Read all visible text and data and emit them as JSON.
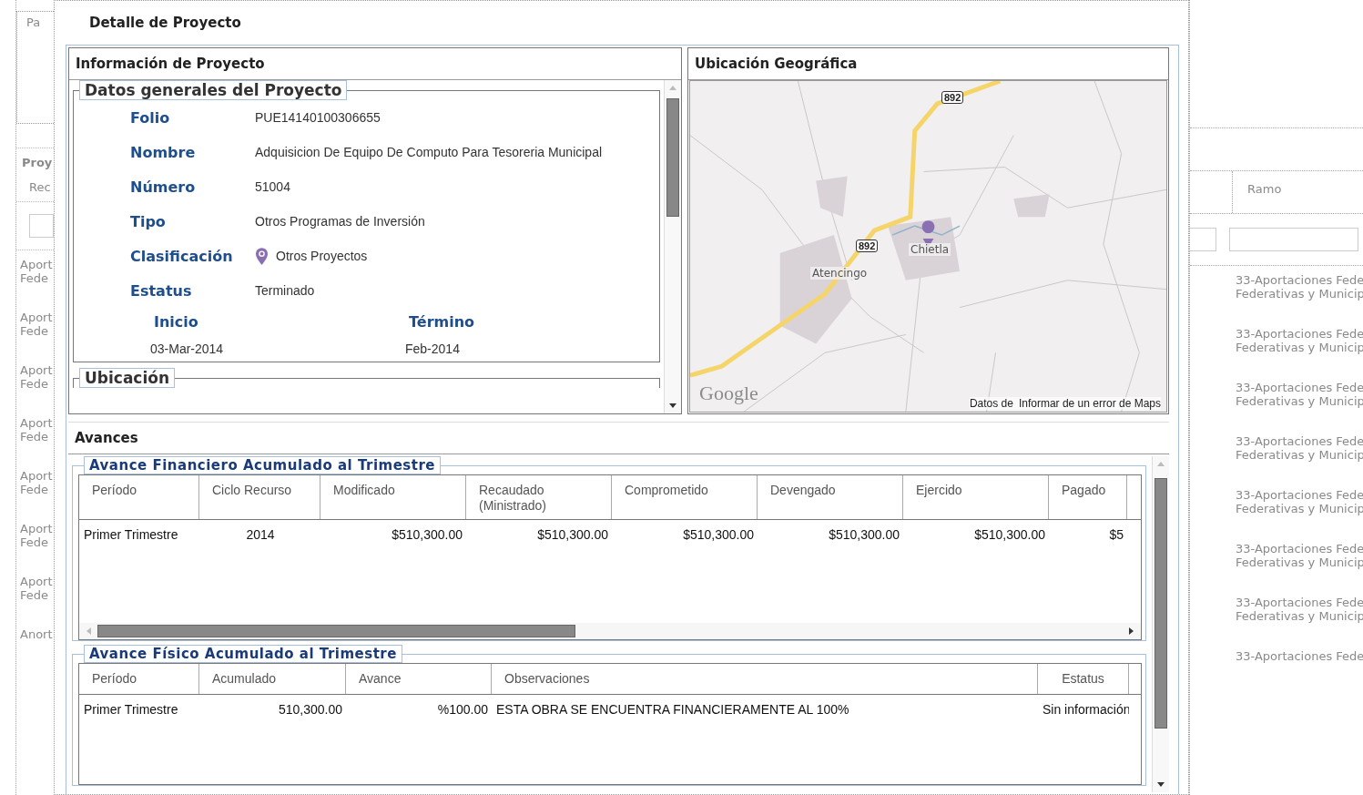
{
  "background_left": {
    "legend": "Pa",
    "panel_title": "Proy",
    "column_header": "Rec",
    "rows": [
      {
        "line_1": "Aport",
        "line_2": "Fede"
      },
      {
        "line_1": "Aport",
        "line_2": "Fede"
      },
      {
        "line_1": "Aport",
        "line_2": "Fede"
      },
      {
        "line_1": "Aport",
        "line_2": "Fede"
      },
      {
        "line_1": "Aport",
        "line_2": "Fede"
      },
      {
        "line_1": "Aport",
        "line_2": "Fede"
      },
      {
        "line_1": "Aport",
        "line_2": "Fede"
      },
      {
        "line_1": "Anort"
      }
    ]
  },
  "background_right": {
    "column_header": "Ramo",
    "rows": [
      {
        "line_1": "33-Aportaciones Fede",
        "line_2": "Federativas y Municip"
      },
      {
        "line_1": "33-Aportaciones Fede",
        "line_2": "Federativas y Municip"
      },
      {
        "line_1": "33-Aportaciones Fede",
        "line_2": "Federativas y Municip"
      },
      {
        "line_1": "33-Aportaciones Fede",
        "line_2": "Federativas y Municip"
      },
      {
        "line_1": "33-Aportaciones Fede",
        "line_2": "Federativas y Municip"
      },
      {
        "line_1": "33-Aportaciones Fede",
        "line_2": "Federativas y Municip"
      },
      {
        "line_1": "33-Aportaciones Fede",
        "line_2": "Federativas y Municip"
      },
      {
        "line_1": "33-Aportaciones Fede"
      }
    ]
  },
  "dialog": {
    "title": "Detalle de Proyecto",
    "info_panel": {
      "title": "Información de Proyecto",
      "section_title": "Datos generales del Proyecto",
      "fields": [
        {
          "label": "Folio",
          "value": "PUE14140100306655",
          "kind": "text"
        },
        {
          "label": "Nombre",
          "value": "Adquisicion De Equipo De Computo Para Tesoreria Municipal",
          "kind": "text"
        },
        {
          "label": "Número",
          "value": "51004",
          "kind": "text"
        },
        {
          "label": "Tipo",
          "value": "Otros Programas de Inversión",
          "kind": "text"
        },
        {
          "label": "Clasificación",
          "value": "Otros Proyectos",
          "kind": "pin"
        },
        {
          "label": "Estatus",
          "value": "Terminado",
          "kind": "text"
        }
      ],
      "dates": [
        {
          "label": "Inicio",
          "value": "03-Mar-2014"
        },
        {
          "label": "Término",
          "value": "Feb-2014"
        }
      ],
      "next_section_title": "Ubicación"
    },
    "map_panel": {
      "title": "Ubicación Geográfica",
      "route_shields": [
        "892",
        "892"
      ],
      "places": [
        "Chietla",
        "Atencingo"
      ],
      "logo": "Google",
      "attribution": "Datos de",
      "report_link": "Informar de un error de Maps"
    },
    "advances": {
      "title": "Avances",
      "financial": {
        "title": "Avance Financiero Acumulado al Trimestre",
        "columns": [
          "Período",
          "Ciclo Recurso",
          "Modificado",
          "Recaudado (Ministrado)",
          "Comprometido",
          "Devengado",
          "Ejercido",
          "Pagado"
        ],
        "rows": [
          [
            "Primer Trimestre",
            "2014",
            "$510,300.00",
            "$510,300.00",
            "$510,300.00",
            "$510,300.00",
            "$510,300.00",
            "$5"
          ]
        ]
      },
      "physical": {
        "title": "Avance Físico Acumulado al Trimestre",
        "columns": [
          "Período",
          "Acumulado",
          "Avance",
          "Observaciones",
          "Estatus"
        ],
        "rows": [
          [
            "Primer Trimestre",
            "510,300.00",
            "%100.00",
            "ESTA OBRA SE ENCUENTRA FINANCIERAMENTE AL 100%",
            "Sin información"
          ]
        ]
      }
    }
  }
}
